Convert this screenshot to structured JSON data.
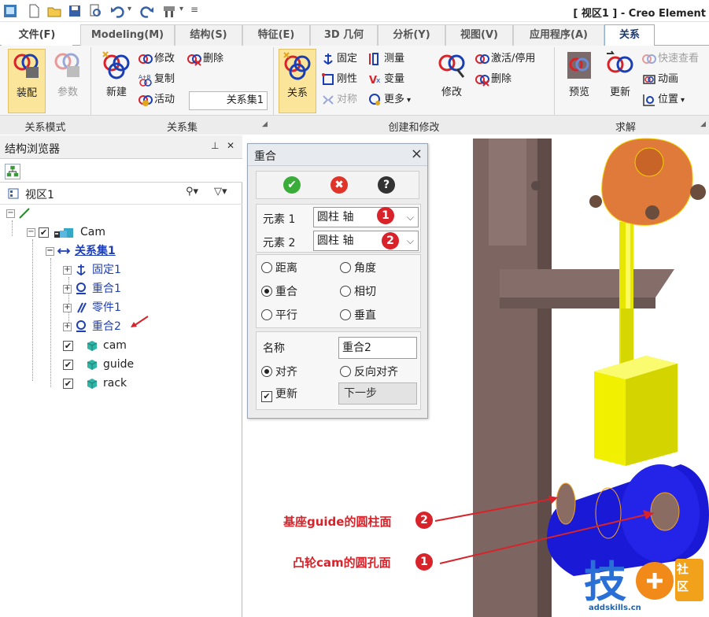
{
  "window": {
    "title": "[ 视区1 ] - Creo Element"
  },
  "tabs": [
    {
      "label": "文件(F)"
    },
    {
      "label": "Modeling(M)"
    },
    {
      "label": "结构(S)"
    },
    {
      "label": "特征(E)"
    },
    {
      "label": "3D 几何"
    },
    {
      "label": "分析(Y)"
    },
    {
      "label": "视图(V)"
    },
    {
      "label": "应用程序(A)"
    },
    {
      "label": "关系"
    }
  ],
  "ribbon": {
    "mode": {
      "assembly": "装配",
      "params": "参数",
      "group_label": "关系模式"
    },
    "relset": {
      "new": "新建",
      "modify": "修改",
      "delete": "删除",
      "copy": "复制",
      "active": "活动",
      "field_value": "关系集1",
      "group_label": "关系集"
    },
    "create": {
      "relation": "关系",
      "fix": "固定",
      "rigid": "刚性",
      "symmetry": "对称",
      "measure": "测量",
      "variable": "变量",
      "more": "更多",
      "modify": "修改",
      "activate": "激活/停用",
      "delete": "删除",
      "group_label": "创建和修改"
    },
    "solve": {
      "preview": "预览",
      "update": "更新",
      "quick_check": "快速查看",
      "animate": "动画",
      "position": "位置",
      "group_label": "求解"
    }
  },
  "browser": {
    "title": "结构浏览器",
    "pin": "⊥",
    "close": "✕",
    "view": "视区1",
    "tree": [
      {
        "label": "Cam"
      },
      {
        "label": "关系集1"
      },
      {
        "label": "固定1"
      },
      {
        "label": "重合1"
      },
      {
        "label": "零件1"
      },
      {
        "label": "重合2"
      },
      {
        "label": "cam"
      },
      {
        "label": "guide"
      },
      {
        "label": "rack"
      }
    ]
  },
  "dialog": {
    "title": "重合",
    "ok": "✔",
    "cancel": "✖",
    "help": "?",
    "element1_label": "元素 1",
    "element1_value": "圆柱 轴",
    "element2_label": "元素 2",
    "element2_value": "圆柱 轴",
    "options": [
      "距离",
      "角度",
      "重合",
      "相切",
      "平行",
      "垂直"
    ],
    "selected_option": "重合",
    "name_label": "名称",
    "name_value": "重合2",
    "align": "对齐",
    "reverse_align": "反向对齐",
    "update": "更新",
    "next": "下一步"
  },
  "badges": {
    "one": "1",
    "two": "2"
  },
  "annotations": {
    "guide_surface": "基座guide的圆柱面",
    "cam_hole": "凸轮cam的圆孔面"
  },
  "watermark": {
    "line1": "社",
    "line2": "区",
    "site": "addskills.cn"
  },
  "colors": {
    "accent": "#d8232a",
    "ribbon_pressed": "#fbe59b",
    "link": "#1f3fb5",
    "cam_blue": "#1a1ad6",
    "guide_yellow": "#f2f21a",
    "base_brown": "#7d6661"
  }
}
